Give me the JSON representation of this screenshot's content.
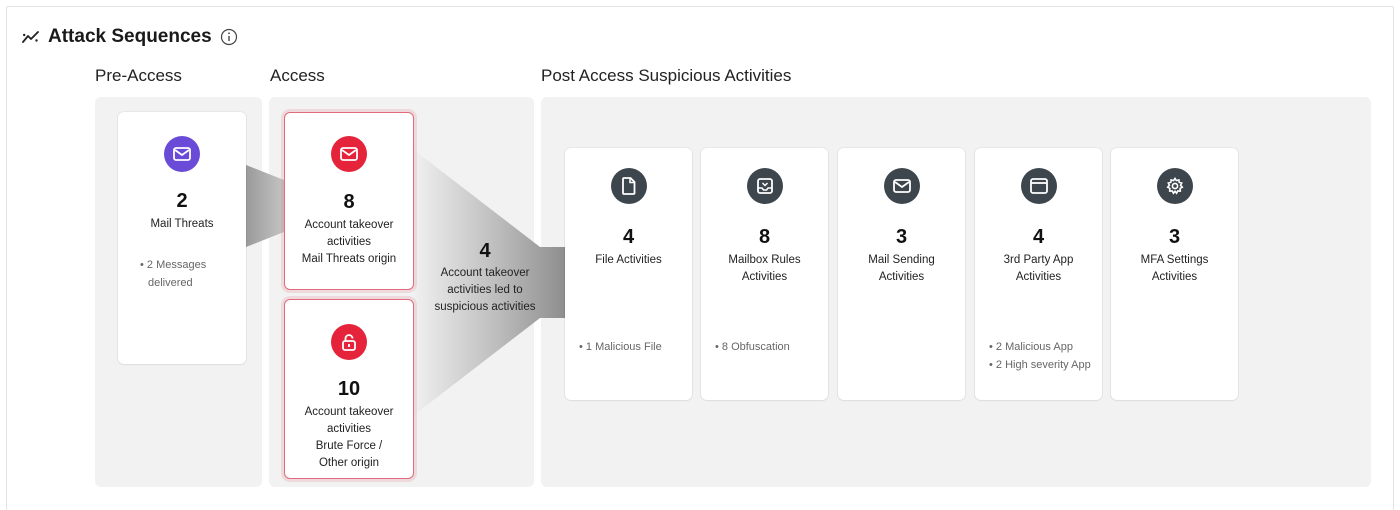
{
  "header": {
    "title": "Attack Sequences",
    "icon": "trend-icon",
    "info_icon": "info-icon"
  },
  "sections": {
    "pre_access": "Pre-Access",
    "access": "Access",
    "post_access": "Post Access Suspicious Activities"
  },
  "colors": {
    "mail_threat": "#6a4bd8",
    "access_red": "#e5233a",
    "post_dark": "#3e464d",
    "panel_bg": "#f2f2f2",
    "access_border": "#e06b7c"
  },
  "pre_access_card": {
    "icon": "mail-icon",
    "count": "2",
    "label": "Mail Threats",
    "details": [
      "• 2 Messages",
      "delivered"
    ]
  },
  "access_cards": [
    {
      "icon": "mail-icon",
      "count": "8",
      "label_lines": [
        "Account takeover",
        "activities",
        "Mail Threats origin"
      ]
    },
    {
      "icon": "unlock-icon",
      "count": "10",
      "label_lines": [
        "Account takeover",
        "activities",
        "Brute Force /",
        "Other origin"
      ]
    }
  ],
  "flow": {
    "count": "4",
    "label_lines": [
      "Account takeover",
      "activities led to",
      "suspicious activities"
    ]
  },
  "post_cards": [
    {
      "icon": "file-icon",
      "count": "4",
      "label_lines": [
        "File Activities"
      ],
      "details": [
        "• 1 Malicious File"
      ]
    },
    {
      "icon": "mailbox-icon",
      "count": "8",
      "label_lines": [
        "Mailbox Rules",
        "Activities"
      ],
      "details": [
        "• 8 Obfuscation"
      ]
    },
    {
      "icon": "mail-icon",
      "count": "3",
      "label_lines": [
        "Mail Sending",
        "Activities"
      ],
      "details": []
    },
    {
      "icon": "app-window-icon",
      "count": "4",
      "label_lines": [
        "3rd Party App",
        "Activities"
      ],
      "details": [
        "• 2 Malicious App",
        "• 2 High severity App"
      ]
    },
    {
      "icon": "gear-icon",
      "count": "3",
      "label_lines": [
        "MFA Settings",
        "Activities"
      ],
      "details": []
    }
  ]
}
